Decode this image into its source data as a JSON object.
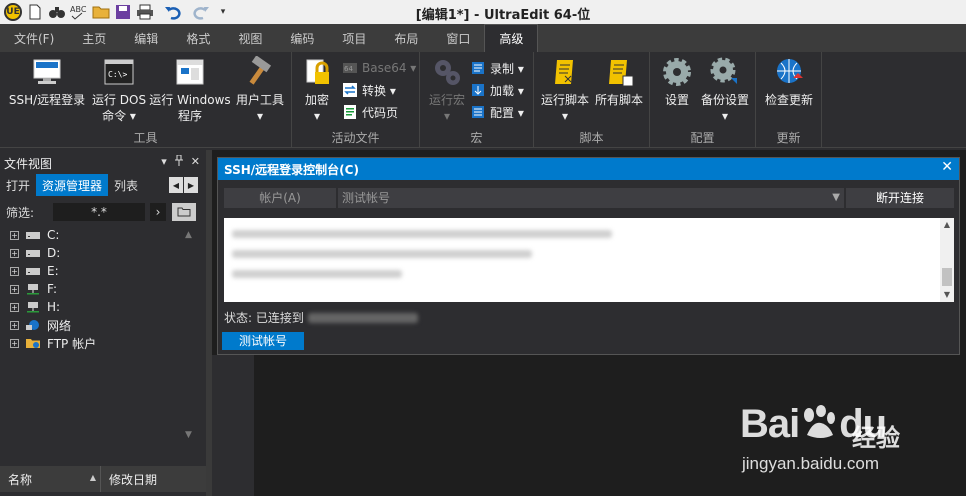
{
  "window": {
    "title": "[编辑1*] - UltraEdit 64-位"
  },
  "quick_access": {
    "icons": [
      "app-logo-icon",
      "new-file-icon",
      "find-icon",
      "spellcheck-icon",
      "open-folder-icon",
      "save-icon",
      "print-icon",
      "undo-icon",
      "redo-icon",
      "customize-icon"
    ],
    "logo_text": "UE"
  },
  "menu": {
    "tabs": [
      "文件(F)",
      "主页",
      "编辑",
      "格式",
      "视图",
      "编码",
      "项目",
      "布局",
      "窗口",
      "高级"
    ],
    "active": "高级"
  },
  "ribbon": {
    "groups": {
      "tools": {
        "label": "工具",
        "buttons": [
          "SSH/远程登录",
          "运行 DOS\n命令 ▾",
          "运行 Windows\n程序",
          "用户工具\n▾"
        ]
      },
      "active_files": {
        "label": "活动文件",
        "encrypt": "加密\n▾",
        "base64": "Base64 ▾",
        "convert": "转换 ▾",
        "codepage": "代码页"
      },
      "macro": {
        "label": "宏",
        "run": "运行宏\n▾",
        "record": "录制 ▾",
        "load": "加载 ▾",
        "config": "配置 ▾"
      },
      "script": {
        "label": "脚本",
        "run": "运行脚本\n▾",
        "all": "所有脚本"
      },
      "config": {
        "label": "配置",
        "settings": "设置",
        "backup": "备份设置\n▾"
      },
      "update": {
        "label": "更新",
        "check": "检查更新"
      }
    }
  },
  "file_view": {
    "title": "文件视图",
    "controls": [
      "▾",
      "📌",
      "✕"
    ],
    "tabs": [
      "打开",
      "资源管理器",
      "列表"
    ],
    "active_tab": "资源管理器",
    "filter_label": "筛选:",
    "filter_value": "*.*",
    "drives": [
      {
        "label": "C:",
        "icon": "drive-icon"
      },
      {
        "label": "D:",
        "icon": "drive-icon"
      },
      {
        "label": "E:",
        "icon": "drive-icon"
      },
      {
        "label": "F:",
        "icon": "network-drive-icon"
      },
      {
        "label": "H:",
        "icon": "network-drive-icon"
      },
      {
        "label": "网络",
        "icon": "network-icon"
      },
      {
        "label": "FTP 帐户",
        "icon": "ftp-icon"
      }
    ],
    "columns": [
      "名称",
      "修改日期"
    ]
  },
  "ssh_dialog": {
    "title": "SSH/远程登录控制台(C)",
    "account_button": "帐户(A)",
    "account_value": "测试帐号",
    "disconnect_button": "断开连接",
    "status_label": "状态: 已连接到",
    "account_tag": "测试帐号"
  },
  "watermark": {
    "logo": "Bai",
    "logo2": "du",
    "cn": "经验",
    "url": "jingyan.baidu.com"
  }
}
